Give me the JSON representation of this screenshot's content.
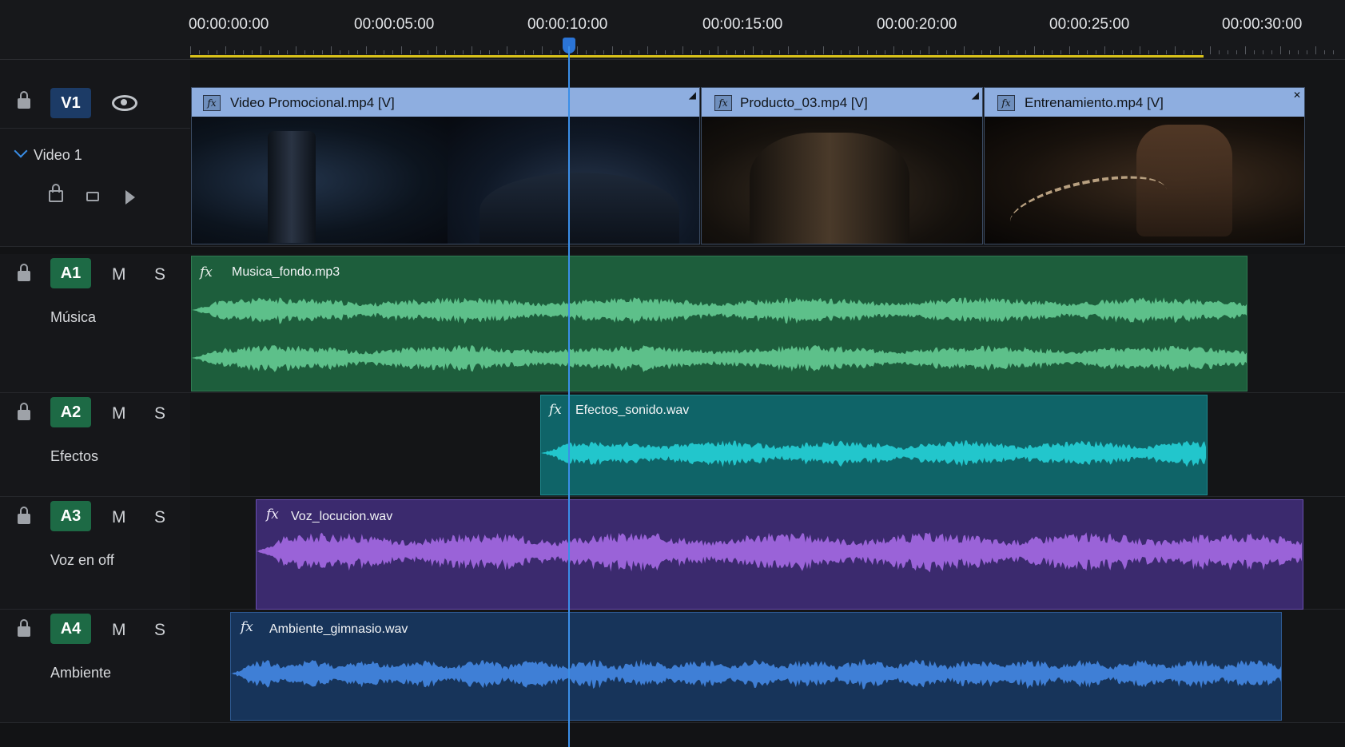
{
  "ruler": {
    "labels": [
      "00:00:00:00",
      "00:00:05:00",
      "00:00:10:00",
      "00:00:15:00",
      "00:00:20:00",
      "00:00:25:00",
      "00:00:30:00"
    ],
    "playhead_time_seconds": 10
  },
  "tracks": {
    "v1": {
      "id": "V1",
      "name": "Video 1",
      "visibility_icon": "eye-icon"
    },
    "a1": {
      "id": "A1",
      "mute": "M",
      "solo": "S",
      "name": "Música"
    },
    "a2": {
      "id": "A2",
      "mute": "M",
      "solo": "S",
      "name": "Efectos",
      "mic_icon": "microphone-icon"
    },
    "a3": {
      "id": "A3",
      "mute": "M",
      "solo": "S",
      "name": "Voz en off",
      "mic_icon": "microphone-icon"
    },
    "a4": {
      "id": "A4",
      "mute": "M",
      "solo": "S",
      "name": "Ambiente",
      "mic_icon": "microphone-icon"
    }
  },
  "clips": {
    "video": [
      {
        "name": "Video Promocional.mp4 [V]"
      },
      {
        "name": "Producto_03.mp4 [V]"
      },
      {
        "name": "Entrenamiento.mp4 [V]"
      }
    ],
    "audio": [
      {
        "name": "Musica_fondo.mp3",
        "fx": "fx",
        "color": "#1d5e3c",
        "wave_color": "#5dc08a"
      },
      {
        "name": "Efectos_sonido.wav",
        "fx": "fx",
        "color": "#0f6468",
        "wave_color": "#22c6cc"
      },
      {
        "name": "Voz_locucion.wav",
        "fx": "fx",
        "color": "#3b2a6e",
        "wave_color": "#9a63d8"
      },
      {
        "name": "Ambiente_gimnasio.wav",
        "fx": "fx",
        "color": "#17345a",
        "wave_color": "#3f7fd6"
      }
    ]
  },
  "colors": {
    "playhead": "#2b74d6",
    "in_out_bar": "#d9c21a",
    "video_clip_bar": "#8eaee0"
  }
}
